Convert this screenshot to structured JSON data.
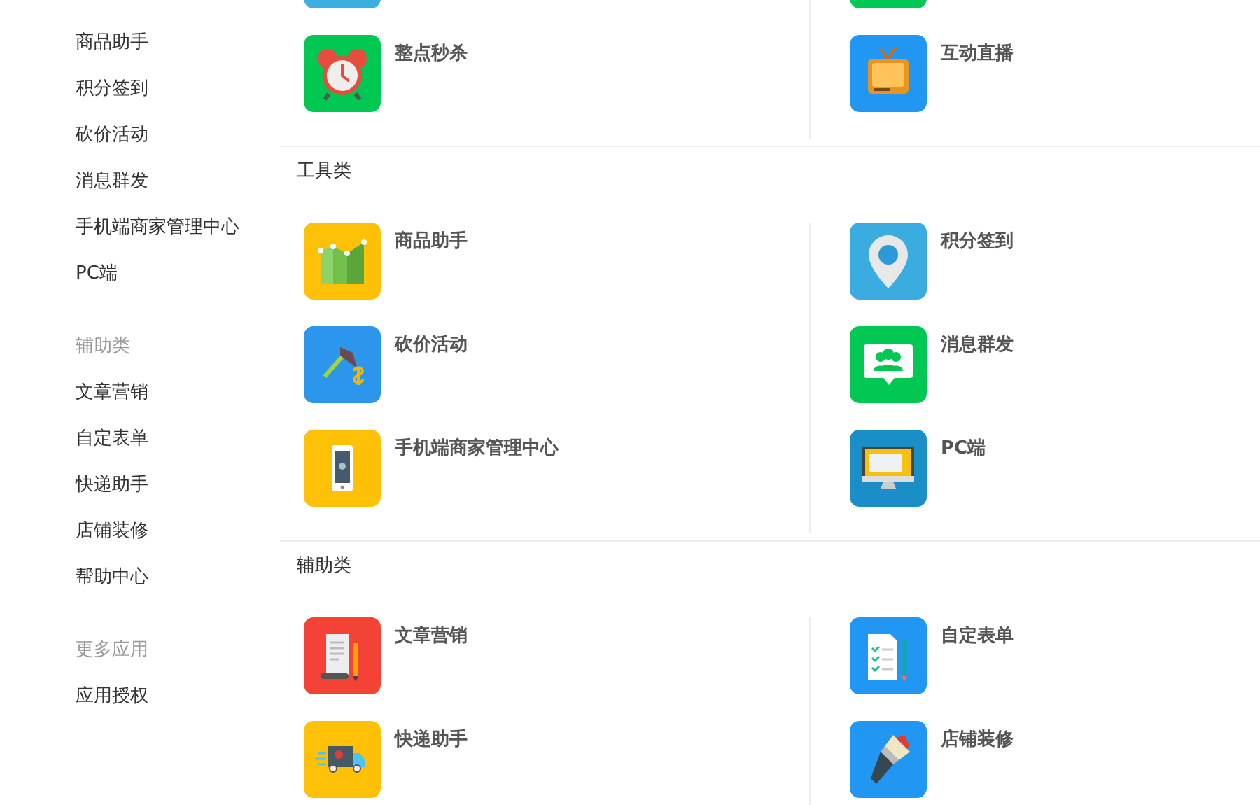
{
  "sidebar": {
    "groups": [
      {
        "items": [
          "商品助手",
          "积分签到",
          "砍价活动",
          "消息群发",
          "手机端商家管理中心",
          "PC端"
        ]
      },
      {
        "heading": "辅助类",
        "items": [
          "文章营销",
          "自定表单",
          "快递助手",
          "店铺装修",
          "帮助中心"
        ]
      },
      {
        "heading": "更多应用",
        "items": [
          "应用授权"
        ]
      }
    ]
  },
  "sections": [
    {
      "cards": [
        {
          "kind": "blank",
          "color": "#3bb0e0"
        },
        {
          "kind": "blank",
          "color": "#00c853"
        },
        {
          "title": "整点秒杀",
          "kind": "clock",
          "color": "#00c853"
        },
        {
          "title": "互动直播",
          "kind": "tv",
          "color": "#2196f3"
        }
      ]
    },
    {
      "title": "工具类",
      "cards": [
        {
          "title": "商品助手",
          "kind": "chart",
          "color": "#ffc107"
        },
        {
          "title": "积分签到",
          "kind": "pin",
          "color": "#3aace0"
        },
        {
          "title": "砍价活动",
          "kind": "axe",
          "color": "#2b96ec"
        },
        {
          "title": "消息群发",
          "kind": "chat",
          "color": "#00c853"
        },
        {
          "title": "手机端商家管理中心",
          "kind": "phone",
          "color": "#ffc107"
        },
        {
          "title": "PC端",
          "kind": "monitor",
          "color": "#1a8ec6"
        }
      ]
    },
    {
      "title": "辅助类",
      "cards": [
        {
          "title": "文章营销",
          "kind": "scroll",
          "color": "#f44336"
        },
        {
          "title": "自定表单",
          "kind": "form",
          "color": "#2196f3"
        },
        {
          "title": "快递助手",
          "kind": "truck",
          "color": "#ffc107"
        },
        {
          "title": "店铺装修",
          "kind": "brush",
          "color": "#2196f3"
        }
      ]
    }
  ]
}
